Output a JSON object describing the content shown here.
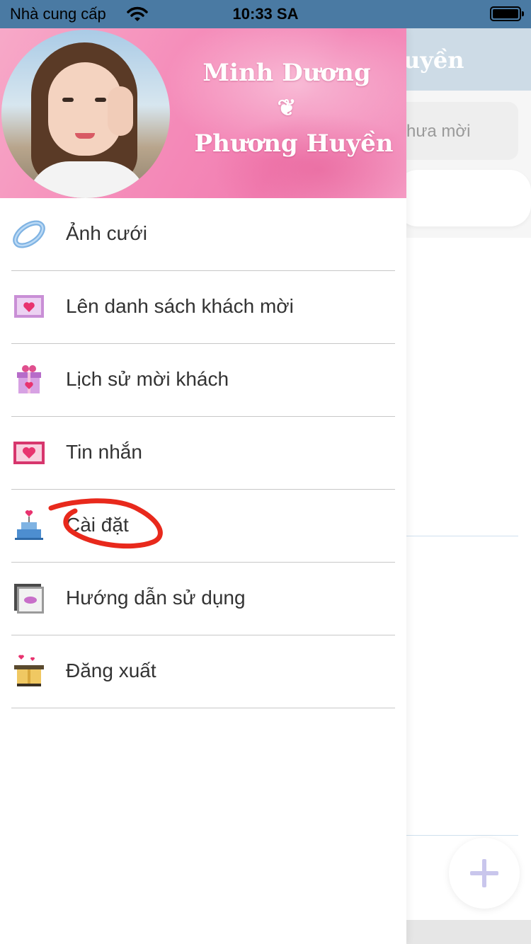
{
  "status_bar": {
    "carrier": "Nhà cung cấp",
    "time": "10:33 SA"
  },
  "background_page": {
    "title_partial": "uyền",
    "search_partial": "hưa mời"
  },
  "drawer": {
    "header": {
      "name_1": "Minh Dương",
      "separator": "❦",
      "name_2": "Phương Huyền"
    },
    "menu": [
      {
        "label": "Ảnh cưới",
        "icon": "ring-icon"
      },
      {
        "label": "Lên danh sách khách mời",
        "icon": "invitation-card-icon"
      },
      {
        "label": "Lịch sử mời khách",
        "icon": "gift-box-icon"
      },
      {
        "label": "Tin nhắn",
        "icon": "message-heart-icon"
      },
      {
        "label": "Cài đặt",
        "icon": "wedding-cake-icon"
      },
      {
        "label": "Hướng dẫn sử dụng",
        "icon": "photo-frame-icon"
      },
      {
        "label": "Đăng xuất",
        "icon": "open-box-icon"
      }
    ]
  },
  "colors": {
    "status_bar": "#4a7aa3",
    "header_pink": "#f58dba",
    "menu_text": "#333333",
    "annotation_red": "#e8291c",
    "fab_plus": "#c9c6ec"
  }
}
